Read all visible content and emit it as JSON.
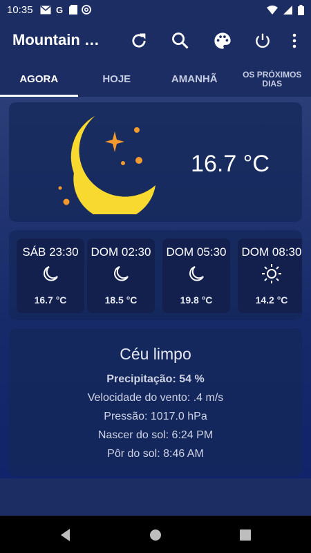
{
  "status": {
    "time": "10:35",
    "left_icons": [
      "gmail-icon",
      "g-icon",
      "sd-card-icon",
      "at-icon"
    ],
    "right_icons": [
      "wifi-icon",
      "signal-icon",
      "battery-icon"
    ]
  },
  "appbar": {
    "title": "Mountain Vi...",
    "actions": [
      "refresh-icon",
      "search-icon",
      "palette-icon",
      "power-icon",
      "more-vert-icon"
    ]
  },
  "tabs": [
    "AGORA",
    "HOJE",
    "AMANHÃ",
    "OS PRÓXIMOS DIAS"
  ],
  "now": {
    "temperature": "16.7 °C",
    "icon": "moon-icon"
  },
  "hours": [
    {
      "label": "SÁB 23:30",
      "icon": "moon-icon",
      "temp": "16.7 °C"
    },
    {
      "label": "DOM 02:30",
      "icon": "moon-icon",
      "temp": "18.5 °C"
    },
    {
      "label": "DOM 05:30",
      "icon": "moon-icon",
      "temp": "19.8 °C"
    },
    {
      "label": "DOM 08:30",
      "icon": "sun-icon",
      "temp": "14.2 °C"
    }
  ],
  "details": {
    "condition": "Céu limpo",
    "precipitation": "Precipitação: 54 %",
    "wind": "Velocidade do vento: .4 m/s",
    "pressure": "Pressão: 1017.0 hPa",
    "sunrise": "Nascer do sol: 6:24 PM",
    "sunset": "Pôr do sol: 8:46 AM"
  },
  "colors": {
    "appbar": "#1c2d64",
    "moon": "#f5d22c",
    "star": "#f39a2c"
  }
}
